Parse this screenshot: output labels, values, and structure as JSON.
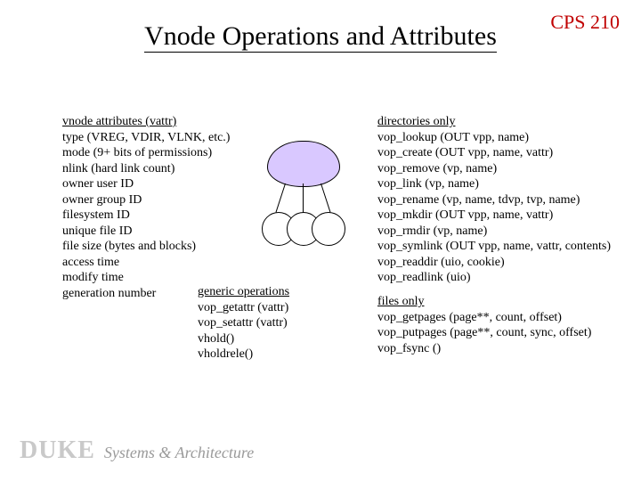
{
  "course_code": "CPS 210",
  "title": "Vnode Operations and Attributes",
  "left": {
    "header": "vnode attributes (vattr)",
    "lines": [
      "type (VREG, VDIR, VLNK, etc.)",
      "mode (9+ bits of permissions)",
      "nlink (hard link count)",
      "owner user ID",
      "owner group ID",
      "filesystem ID",
      "unique file ID",
      "file size (bytes and blocks)",
      "access time",
      "modify time",
      "generation number"
    ]
  },
  "generic": {
    "header": "generic operations",
    "lines": [
      "vop_getattr  (vattr)",
      "vop_setattr (vattr)",
      "vhold()",
      "vholdrele()"
    ]
  },
  "dirs": {
    "header": "directories only",
    "lines": [
      "vop_lookup (OUT vpp, name)",
      "vop_create (OUT vpp, name, vattr)",
      "vop_remove (vp, name)",
      "vop_link (vp, name)",
      "vop_rename (vp, name, tdvp, tvp, name)",
      "vop_mkdir (OUT vpp, name, vattr)",
      "vop_rmdir (vp, name)",
      "vop_symlink (OUT vpp, name, vattr, contents)",
      "vop_readdir (uio, cookie)",
      "vop_readlink (uio)"
    ]
  },
  "files": {
    "header": "files only",
    "lines": [
      "vop_getpages (page**, count, offset)",
      "vop_putpages (page**, count, sync, offset)",
      "vop_fsync ()"
    ]
  },
  "footer": {
    "duke": "DUKE",
    "sa": "Systems & Architecture"
  }
}
